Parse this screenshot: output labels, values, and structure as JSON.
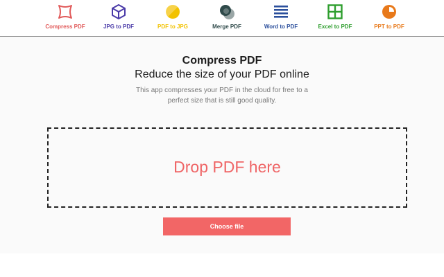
{
  "nav": {
    "items": [
      {
        "label": "Compress PDF",
        "icon": "compress-icon",
        "color": "#e15b5b"
      },
      {
        "label": "JPG to PDF",
        "icon": "cube-icon",
        "color": "#4a3aa8"
      },
      {
        "label": "PDF to JPG",
        "icon": "half-circle-icon",
        "color": "#f2c200"
      },
      {
        "label": "Merge PDF",
        "icon": "merge-circles-icon",
        "color": "#2f4a4a"
      },
      {
        "label": "Word to PDF",
        "icon": "lines-icon",
        "color": "#2b4f9c"
      },
      {
        "label": "Excel to PDF",
        "icon": "grid-icon",
        "color": "#2e9e2e"
      },
      {
        "label": "PPT to PDF",
        "icon": "pie-icon",
        "color": "#e8791a"
      }
    ]
  },
  "main": {
    "title": "Compress PDF",
    "subtitle": "Reduce the size of your PDF online",
    "description": "This app compresses your PDF in the cloud for free to a perfect size that is still good quality.",
    "drop_text": "Drop PDF here",
    "choose_label": "Choose file"
  },
  "colors": {
    "accent": "#f26666",
    "background": "#fafafa"
  }
}
